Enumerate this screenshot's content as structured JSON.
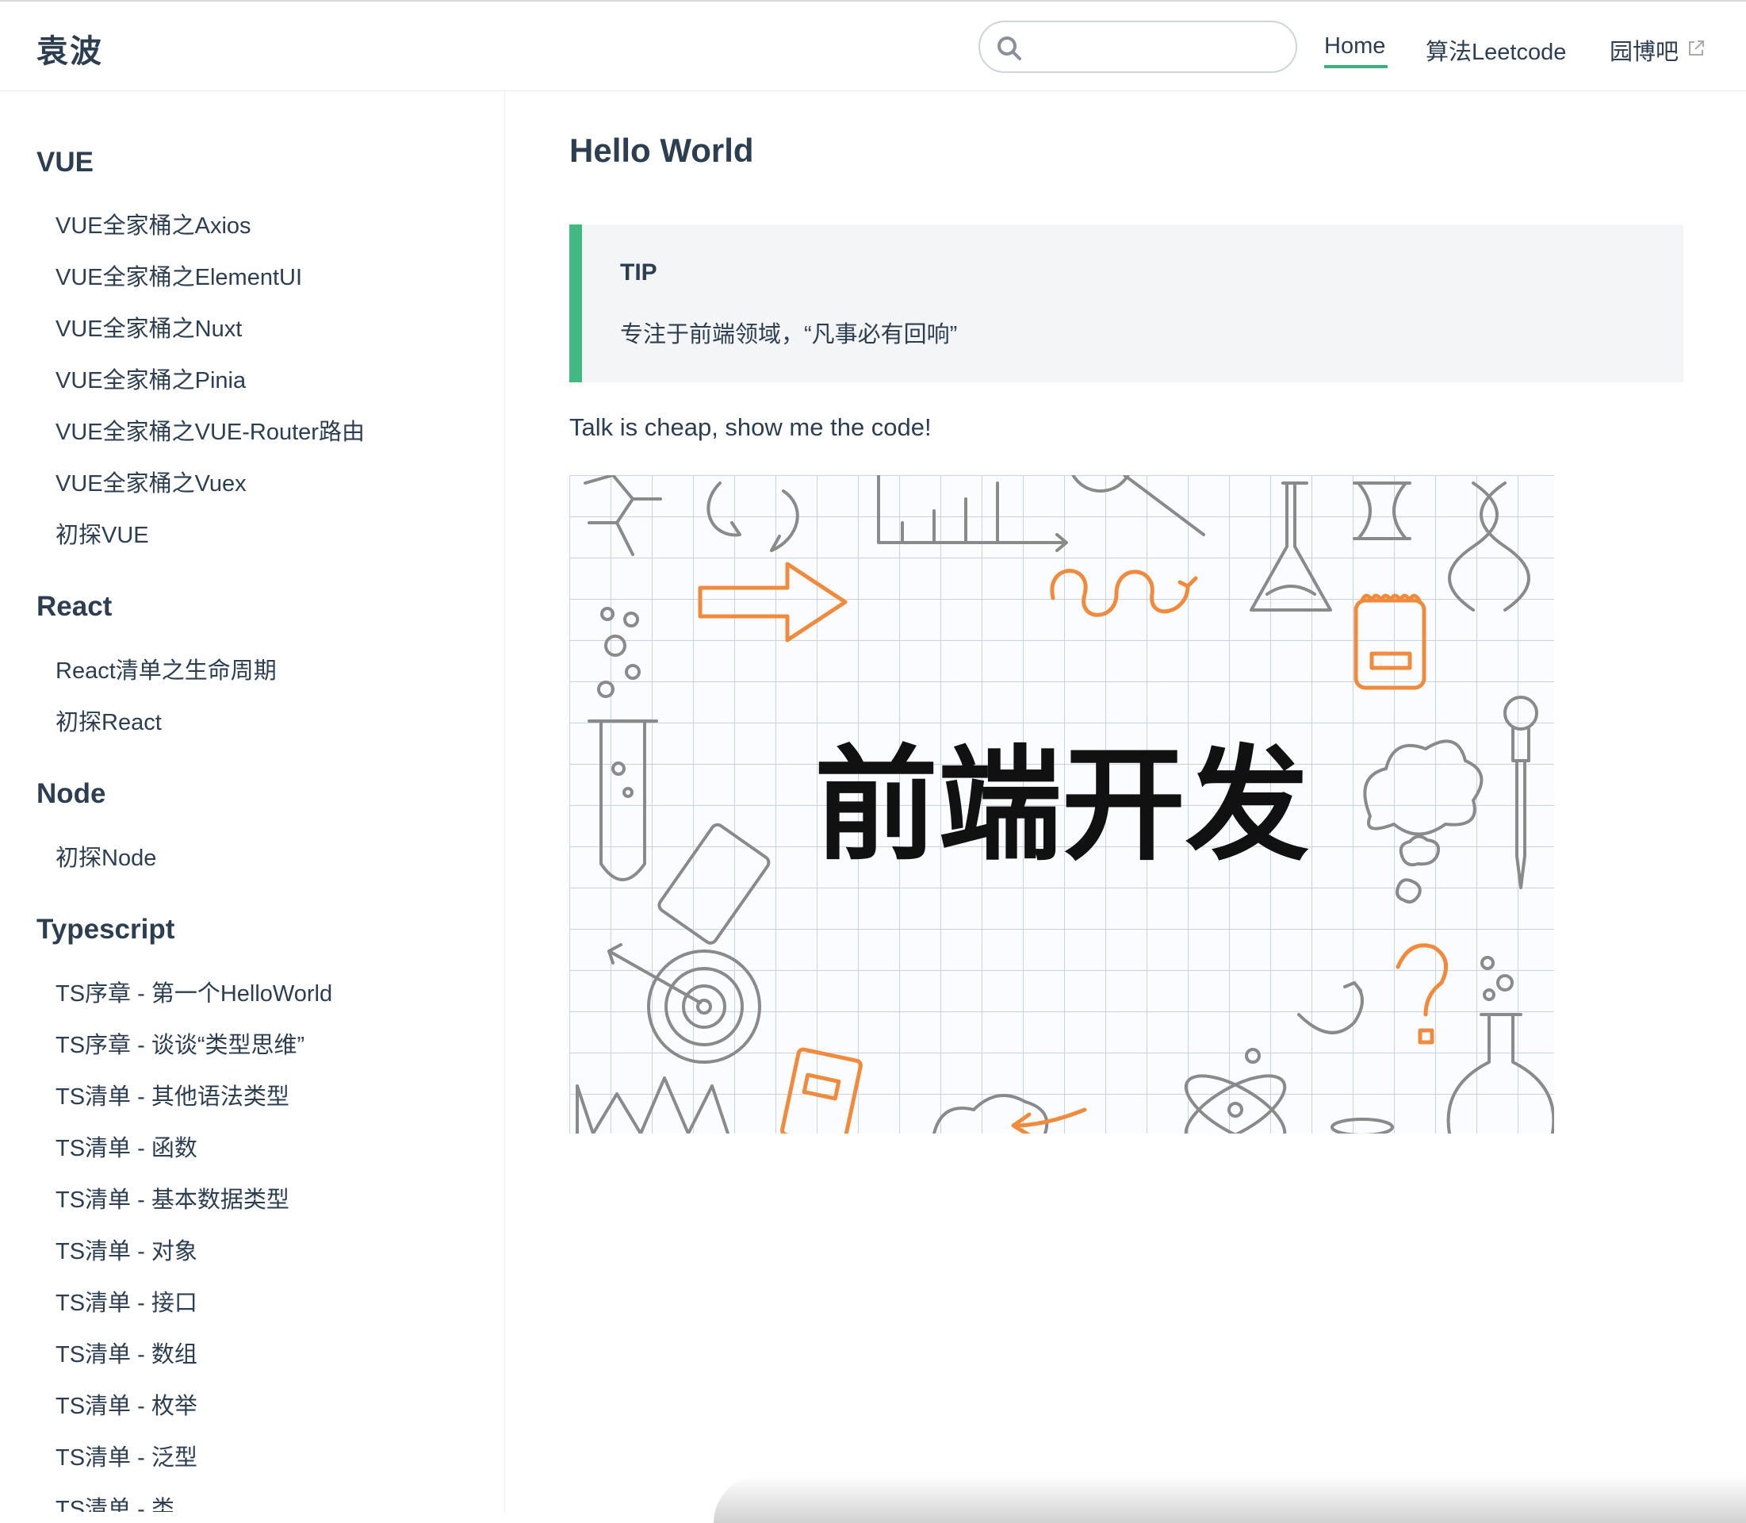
{
  "header": {
    "site_name": "袁波",
    "search": {
      "value": "",
      "placeholder": ""
    },
    "nav": [
      {
        "label": "Home",
        "active": true
      },
      {
        "label": "算法Leetcode",
        "active": false
      },
      {
        "label": "园博吧",
        "active": false,
        "external": true
      }
    ]
  },
  "sidebar": {
    "groups": [
      {
        "title": "VUE",
        "items": [
          "VUE全家桶之Axios",
          "VUE全家桶之ElementUI",
          "VUE全家桶之Nuxt",
          "VUE全家桶之Pinia",
          "VUE全家桶之VUE-Router路由",
          "VUE全家桶之Vuex",
          "初探VUE"
        ]
      },
      {
        "title": "React",
        "items": [
          "React清单之生命周期",
          "初探React"
        ]
      },
      {
        "title": "Node",
        "items": [
          "初探Node"
        ]
      },
      {
        "title": "Typescript",
        "items": [
          "TS序章 - 第一个HelloWorld",
          "TS序章 - 谈谈“类型思维”",
          "TS清单 - 其他语法类型",
          "TS清单 - 函数",
          "TS清单 - 基本数据类型",
          "TS清单 - 对象",
          "TS清单 - 接口",
          "TS清单 - 数组",
          "TS清单 - 枚举",
          "TS清单 - 泛型",
          "TS清单 - 类"
        ]
      }
    ]
  },
  "main": {
    "title": "Hello World",
    "tip": {
      "title": "TIP",
      "body": "专注于前端领域，“凡事必有回响”"
    },
    "tagline": "Talk is cheap, show me the code!",
    "banner": {
      "text": "前端开发"
    }
  },
  "colors": {
    "accent": "#3eaf7c",
    "tip_border": "#42b983",
    "text": "#2c3e50",
    "orange": "#f08a3c",
    "sketch_gray": "#8a8a8a"
  },
  "icons": {
    "search": "search-icon",
    "external": "external-link-icon"
  }
}
